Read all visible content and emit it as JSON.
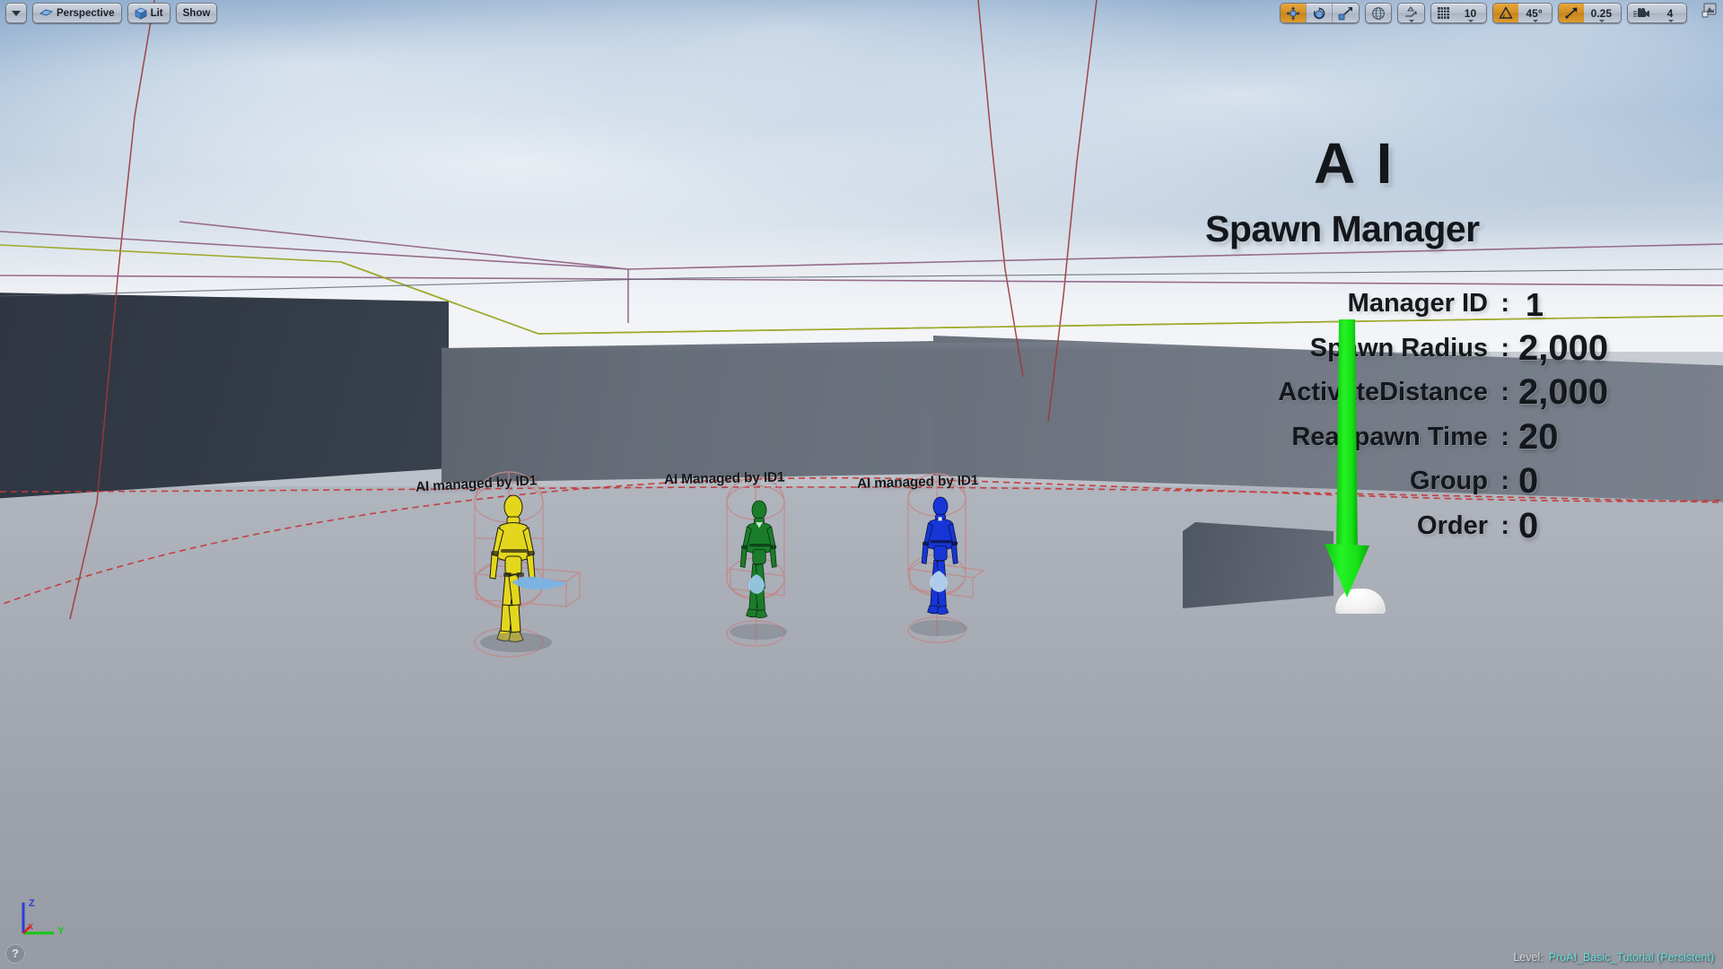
{
  "viewport": {
    "left_toolbar": [
      {
        "name": "viewport-options",
        "icon": "chevron-down-icon",
        "label": ""
      },
      {
        "name": "view-mode-perspective",
        "icon": "perspective-icon",
        "label": "Perspective"
      },
      {
        "name": "view-mode-lit",
        "icon": "cube-icon",
        "label": "Lit"
      },
      {
        "name": "show-flags",
        "icon": "",
        "label": "Show"
      }
    ],
    "right_toolbar": {
      "transform_tools": [
        {
          "name": "translate-mode-button",
          "icon": "move-gizmo-icon",
          "label": "",
          "active": true
        },
        {
          "name": "rotate-mode-button",
          "icon": "rotate-gizmo-icon",
          "label": "",
          "active": false
        },
        {
          "name": "scale-mode-button",
          "icon": "scale-gizmo-icon",
          "label": "",
          "active": false
        }
      ],
      "coordinate_system": {
        "name": "world-space-toggle",
        "icon": "globe-icon",
        "label": ""
      },
      "surface_snap": {
        "name": "surface-snapping-toggle",
        "icon": "surface-snap-icon",
        "label": ""
      },
      "grid_snap": {
        "name": "grid-snap-toggle",
        "icon": "grid-icon",
        "label": "",
        "value": "10"
      },
      "angle_snap": {
        "name": "angle-snap-toggle",
        "icon": "angle-icon",
        "label": "",
        "value": "45°",
        "active": true
      },
      "scale_snap": {
        "name": "scale-snap-toggle",
        "icon": "scale-snap-arrow-icon",
        "label": "",
        "value": "0.25",
        "active": true
      },
      "camera_speed": {
        "name": "camera-speed-control",
        "icon": "camera-icon",
        "label": "",
        "value": "4"
      },
      "maximize": {
        "name": "maximize-viewport-button",
        "icon": "maximize-icon",
        "label": ""
      }
    },
    "level_status": {
      "prefix": "Level:",
      "name": "ProAI_Basic_Tutorial (Persistent)"
    },
    "axis_gizmo": {
      "x": "X",
      "y": "Y",
      "z": "Z"
    },
    "help_button": "?"
  },
  "hud_panel": {
    "title_line1": "A I",
    "title_line2": "Spawn Manager",
    "properties": [
      {
        "key": "Manager ID",
        "colon": ":",
        "value": "1"
      },
      {
        "key": "Spawn Radius",
        "colon": ":",
        "value": "2,000"
      },
      {
        "key": "ActivateDistance",
        "colon": ":",
        "value": "2,000"
      },
      {
        "key": "Reaspawn Time",
        "colon": ":",
        "value": "20"
      },
      {
        "key": "Group",
        "colon": ":",
        "value": "0"
      },
      {
        "key": "Order",
        "colon": ":",
        "value": "0"
      }
    ]
  },
  "actors": [
    {
      "name": "ai-yellow",
      "label": "AI managed by ID1",
      "color": "#e8dc1e"
    },
    {
      "name": "ai-green",
      "label": "AI Managed by ID1",
      "color": "#1b8a2c"
    },
    {
      "name": "ai-blue",
      "label": "AI managed by ID1",
      "color": "#1a46e0"
    }
  ],
  "colors": {
    "accent_orange": "#d38f22",
    "spawn_arrow_green": "#17e817",
    "spawn_radius_red": "#c03030",
    "navmesh_yellow": "#9aa520",
    "volume_magenta": "#8b5a7e",
    "level_name_cyan": "#66e0de"
  }
}
